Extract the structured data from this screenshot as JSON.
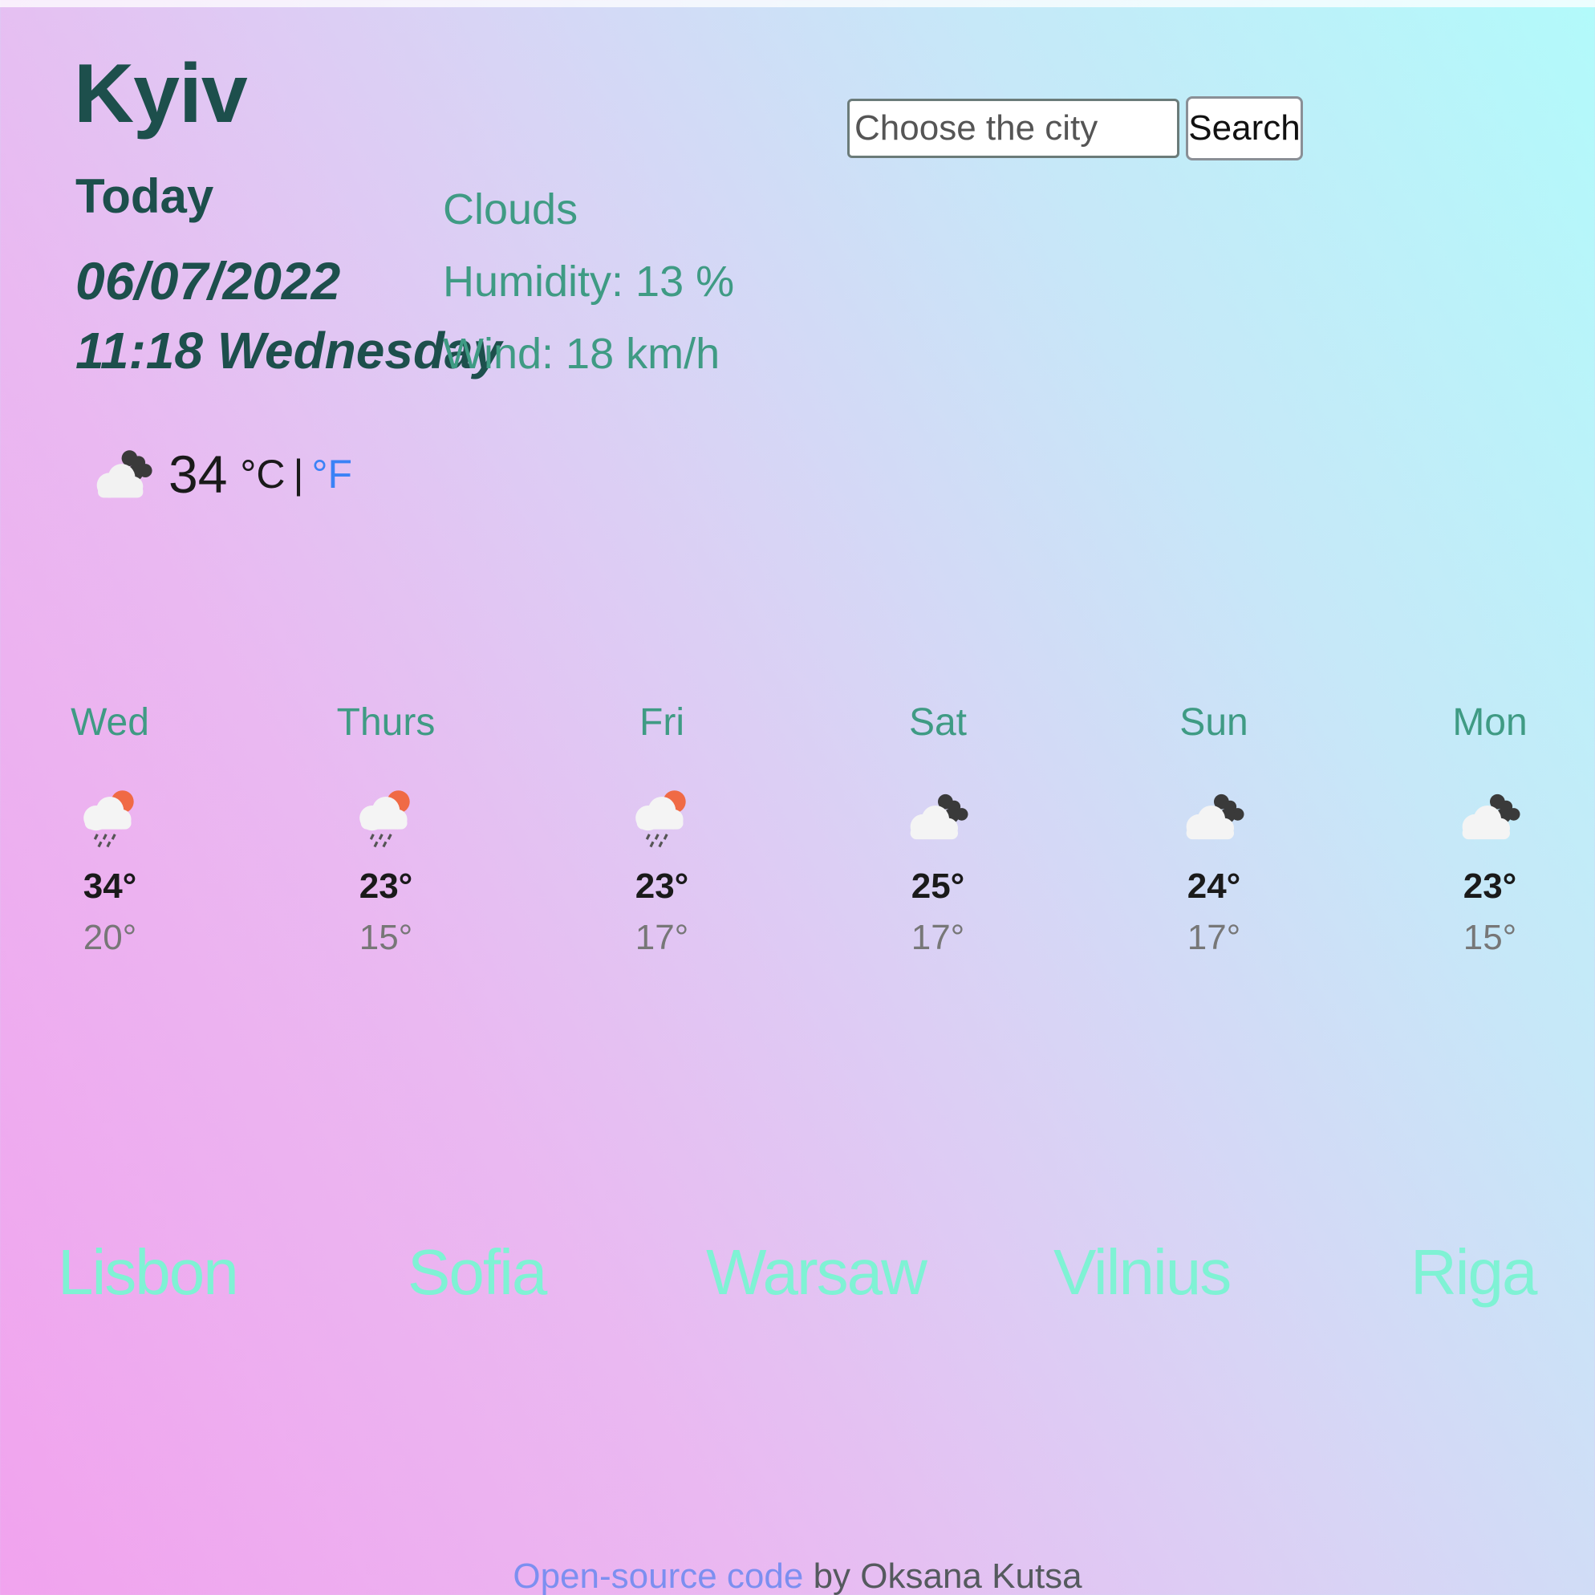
{
  "header": {
    "city": "Kyiv",
    "today_label": "Today",
    "date": "06/07/2022",
    "time_day": "11:18 Wednesday"
  },
  "conditions": {
    "description": "Clouds",
    "humidity": "Humidity: 13 %",
    "wind": "Wind: 18 km/h"
  },
  "search": {
    "placeholder": "Choose the city",
    "button_label": "Search"
  },
  "current": {
    "icon": "broken-clouds-icon",
    "temperature": "34",
    "unit_c": "°C",
    "separator": "|",
    "unit_f": "°F"
  },
  "forecast": [
    {
      "day": "Wed",
      "icon": "rain-sun-icon",
      "high": "34°",
      "low": "20°"
    },
    {
      "day": "Thurs",
      "icon": "rain-sun-icon",
      "high": "23°",
      "low": "15°"
    },
    {
      "day": "Fri",
      "icon": "rain-sun-icon",
      "high": "23°",
      "low": "17°"
    },
    {
      "day": "Sat",
      "icon": "broken-clouds-icon",
      "high": "25°",
      "low": "17°"
    },
    {
      "day": "Sun",
      "icon": "broken-clouds-icon",
      "high": "24°",
      "low": "17°"
    },
    {
      "day": "Mon",
      "icon": "broken-clouds-icon",
      "high": "23°",
      "low": "15°"
    }
  ],
  "quick_cities": [
    "Lisbon",
    "Sofia",
    "Warsaw",
    "Vilnius",
    "Riga"
  ],
  "footer": {
    "link_text": "Open-source code",
    "author_text": " by Oksana Kutsa"
  },
  "colors": {
    "heading": "#1d4f4c",
    "accent_green": "#3f9b84",
    "city_links": "#7ff2d4",
    "fahrenheit_link": "#3b82f6",
    "footer_link": "#7c8ff0"
  }
}
